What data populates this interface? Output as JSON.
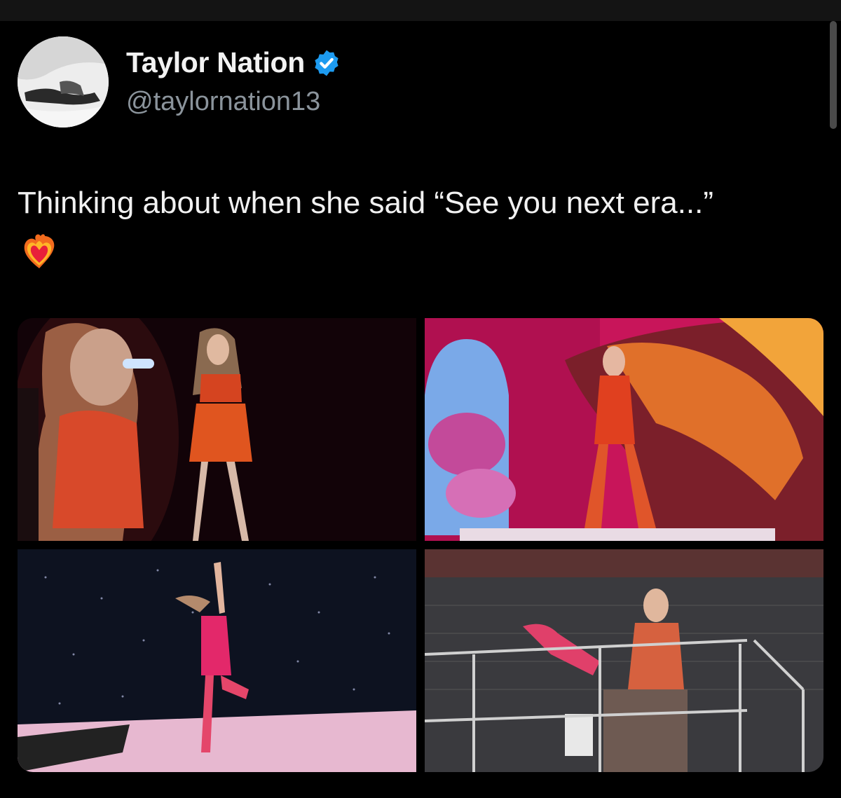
{
  "author": {
    "display_name": "Taylor Nation",
    "handle": "@taylornation13",
    "verified": true,
    "verified_color": "#1d9bf0"
  },
  "tweet": {
    "text": "Thinking about when she said “See you next era...”",
    "emoji": "heart-on-fire"
  },
  "media": {
    "count": 4,
    "images": [
      {
        "name": "photo-1"
      },
      {
        "name": "photo-2"
      },
      {
        "name": "photo-3"
      },
      {
        "name": "photo-4"
      }
    ]
  }
}
